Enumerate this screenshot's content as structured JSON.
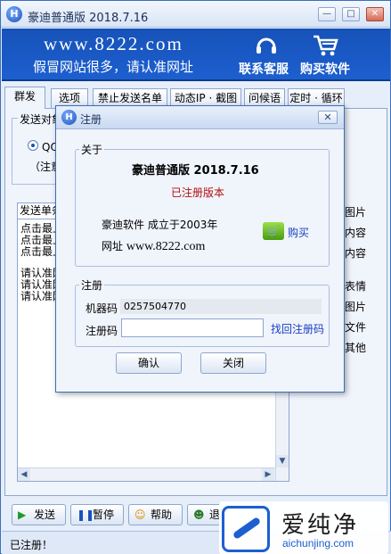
{
  "window": {
    "title": "豪迪普通版 2018.7.16",
    "min_glyph": "—",
    "max_glyph": "□",
    "close_glyph": "✕"
  },
  "banner": {
    "url": "www.8222.com",
    "slogan": "假冒网站很多，请认准网址",
    "contact_label": "联系客服",
    "buy_label": "购买软件"
  },
  "tabs": [
    {
      "label": "群发"
    },
    {
      "label": "选项"
    },
    {
      "label": "禁止发送名单"
    },
    {
      "label": "动态IP · 截图"
    },
    {
      "label": "问候语"
    },
    {
      "label": "定时 · 循环"
    }
  ],
  "send_target": {
    "title": "发送对象",
    "radio_label": "QQ好友",
    "note": "（注意"
  },
  "send_tab_label": "发送单条",
  "textarea_lines": [
    "点击最上",
    "点击最上",
    "点击最上",
    "",
    "请认准网",
    "请认准网",
    "请认准网"
  ],
  "side_items": [
    "图片",
    "内容",
    "内容",
    "表情",
    "图片",
    "文件",
    "其他"
  ],
  "bottom_buttons": {
    "send": "发送",
    "pause": "暂停",
    "help": "帮助",
    "more": "退出"
  },
  "status": "已注册！",
  "watermark": {
    "cn": "爱纯净",
    "en": "aichunjing.com"
  },
  "dialog": {
    "title": "注册",
    "close_glyph": "✕",
    "about_legend": "关于",
    "product_name": "豪迪普通版  2018.7.16",
    "registered_text": "已注册版本",
    "company": "豪迪软件    成立于2003年",
    "url_label": "网址",
    "url_value": "www.8222.com",
    "buy_link": "购买",
    "reg_legend": "注册",
    "machine_code_label": "机器码",
    "machine_code_value": "0257504770",
    "reg_code_label": "注册码",
    "reg_code_value": "",
    "recover_link": "找回注册码",
    "ok_button": "确认",
    "close_button": "关闭"
  }
}
